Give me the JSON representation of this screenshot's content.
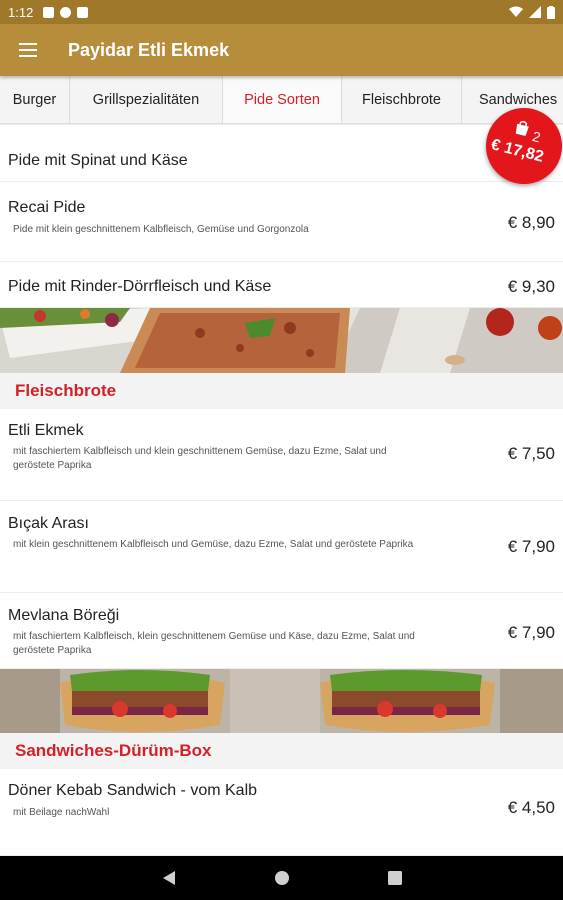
{
  "status_bar": {
    "time": "1:12"
  },
  "app_bar": {
    "title": "Payidar Etli Ekmek"
  },
  "tabs": [
    {
      "label": "Burger"
    },
    {
      "label": "Grillspezialitäten"
    },
    {
      "label": "Pide Sorten",
      "active": true
    },
    {
      "label": "Fleischbrote"
    },
    {
      "label": "Sandwiches"
    }
  ],
  "cart": {
    "count": "2",
    "total": "€ 17,82"
  },
  "pide_items": [
    {
      "name": "Pide mit Spinat und Käse"
    },
    {
      "name": "Recai Pide",
      "desc": "Pide mit klein geschnittenem Kalbfleisch, Gemüse und Gorgonzola",
      "price": "€ 8,90"
    },
    {
      "name": "Pide mit Rinder-Dörrfleisch und Käse",
      "price": "€ 9,30"
    }
  ],
  "fleischbrote": {
    "header": "Fleischbrote",
    "items": [
      {
        "name": "Etli Ekmek",
        "desc": "mit faschiertem Kalbfleisch und klein geschnittenem Gemüse, dazu Ezme, Salat und geröstete Paprika",
        "price": "€ 7,50"
      },
      {
        "name": "Bıçak Arası",
        "desc": "mit klein geschnittenem Kalbfleisch und Gemüse, dazu Ezme, Salat und geröstete Paprika",
        "price": "€ 7,90"
      },
      {
        "name": "Mevlana Böreği",
        "desc": "mit faschiertem Kalbfleisch, klein geschnittenem Gemüse und Käse, dazu Ezme, Salat und geröstete Paprika",
        "price": "€ 7,90"
      }
    ]
  },
  "sandwiches": {
    "header": "Sandwiches-Dürüm-Box",
    "items": [
      {
        "name": "Döner Kebab Sandwich - vom Kalb",
        "desc": "mit Beilage nachWahl",
        "price": "€ 4,50"
      }
    ]
  },
  "colors": {
    "status_bar": "#a0782a",
    "app_bar": "#b68d3a",
    "accent_red": "#d61f26",
    "cart_red": "#e3161b"
  }
}
